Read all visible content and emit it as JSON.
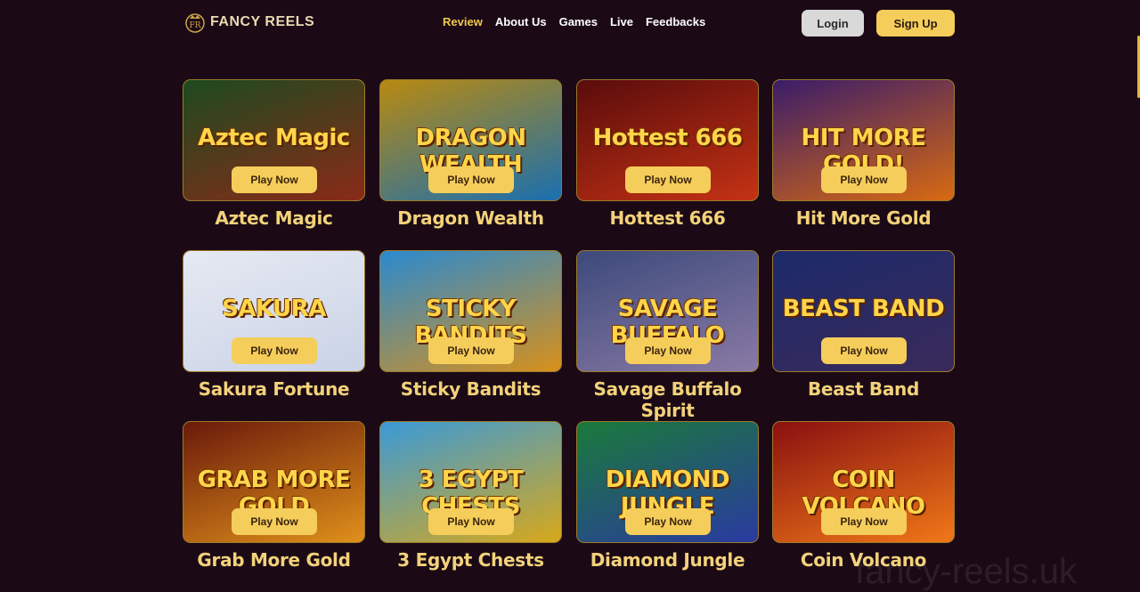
{
  "brand": {
    "logo_text": "FANCY REELS"
  },
  "nav": {
    "items": [
      {
        "label": "Review",
        "active": true
      },
      {
        "label": "About Us",
        "active": false
      },
      {
        "label": "Games",
        "active": false
      },
      {
        "label": "Live",
        "active": false
      },
      {
        "label": "Feedbacks",
        "active": false
      }
    ]
  },
  "auth": {
    "login_label": "Login",
    "signup_label": "Sign Up"
  },
  "games": [
    {
      "name": "Aztec Magic",
      "thumb_text": "Aztec Magic",
      "play_label": "Play Now",
      "colors": [
        "#1d4a1f",
        "#8a2a18"
      ]
    },
    {
      "name": "Dragon Wealth",
      "thumb_text": "DRAGON WEALTH",
      "play_label": "Play Now",
      "colors": [
        "#b98a10",
        "#1a6fb0"
      ]
    },
    {
      "name": "Hottest 666",
      "thumb_text": "Hottest 666",
      "play_label": "Play Now",
      "colors": [
        "#5a0c0c",
        "#c43214"
      ]
    },
    {
      "name": "Hit More Gold",
      "thumb_text": "HIT MORE GOLD!",
      "play_label": "Play Now",
      "colors": [
        "#3a1c6a",
        "#d86a12"
      ]
    },
    {
      "name": "Sakura Fortune",
      "thumb_text": "SAKURA",
      "play_label": "Play Now",
      "colors": [
        "#e6e9f2",
        "#c9d3e6"
      ]
    },
    {
      "name": "Sticky Bandits",
      "thumb_text": "STICKY BANDITS",
      "play_label": "Play Now",
      "colors": [
        "#2a8ad0",
        "#d8901a"
      ]
    },
    {
      "name": "Savage Buffalo Spirit",
      "thumb_text": "SAVAGE BUFFALO",
      "play_label": "Play Now",
      "colors": [
        "#3c4a7a",
        "#8a7aa6"
      ]
    },
    {
      "name": "Beast Band",
      "thumb_text": "BEAST BAND",
      "play_label": "Play Now",
      "colors": [
        "#1c2a6a",
        "#3a2a5a"
      ]
    },
    {
      "name": "Grab More Gold",
      "thumb_text": "GRAB MORE GOLD",
      "play_label": "Play Now",
      "colors": [
        "#6a1a0a",
        "#e0901a"
      ]
    },
    {
      "name": "3 Egypt Chests",
      "thumb_text": "3 EGYPT CHESTS",
      "play_label": "Play Now",
      "colors": [
        "#3a9ad8",
        "#d8a81a"
      ]
    },
    {
      "name": "Diamond Jungle",
      "thumb_text": "DIAMOND JUNGLE",
      "play_label": "Play Now",
      "colors": [
        "#1a7a3a",
        "#2a3aa0"
      ]
    },
    {
      "name": "Coin Volcano",
      "thumb_text": "COIN VOLCANO",
      "play_label": "Play Now",
      "colors": [
        "#8a1010",
        "#f07818"
      ]
    }
  ],
  "watermark": "fancy-reels.uk"
}
